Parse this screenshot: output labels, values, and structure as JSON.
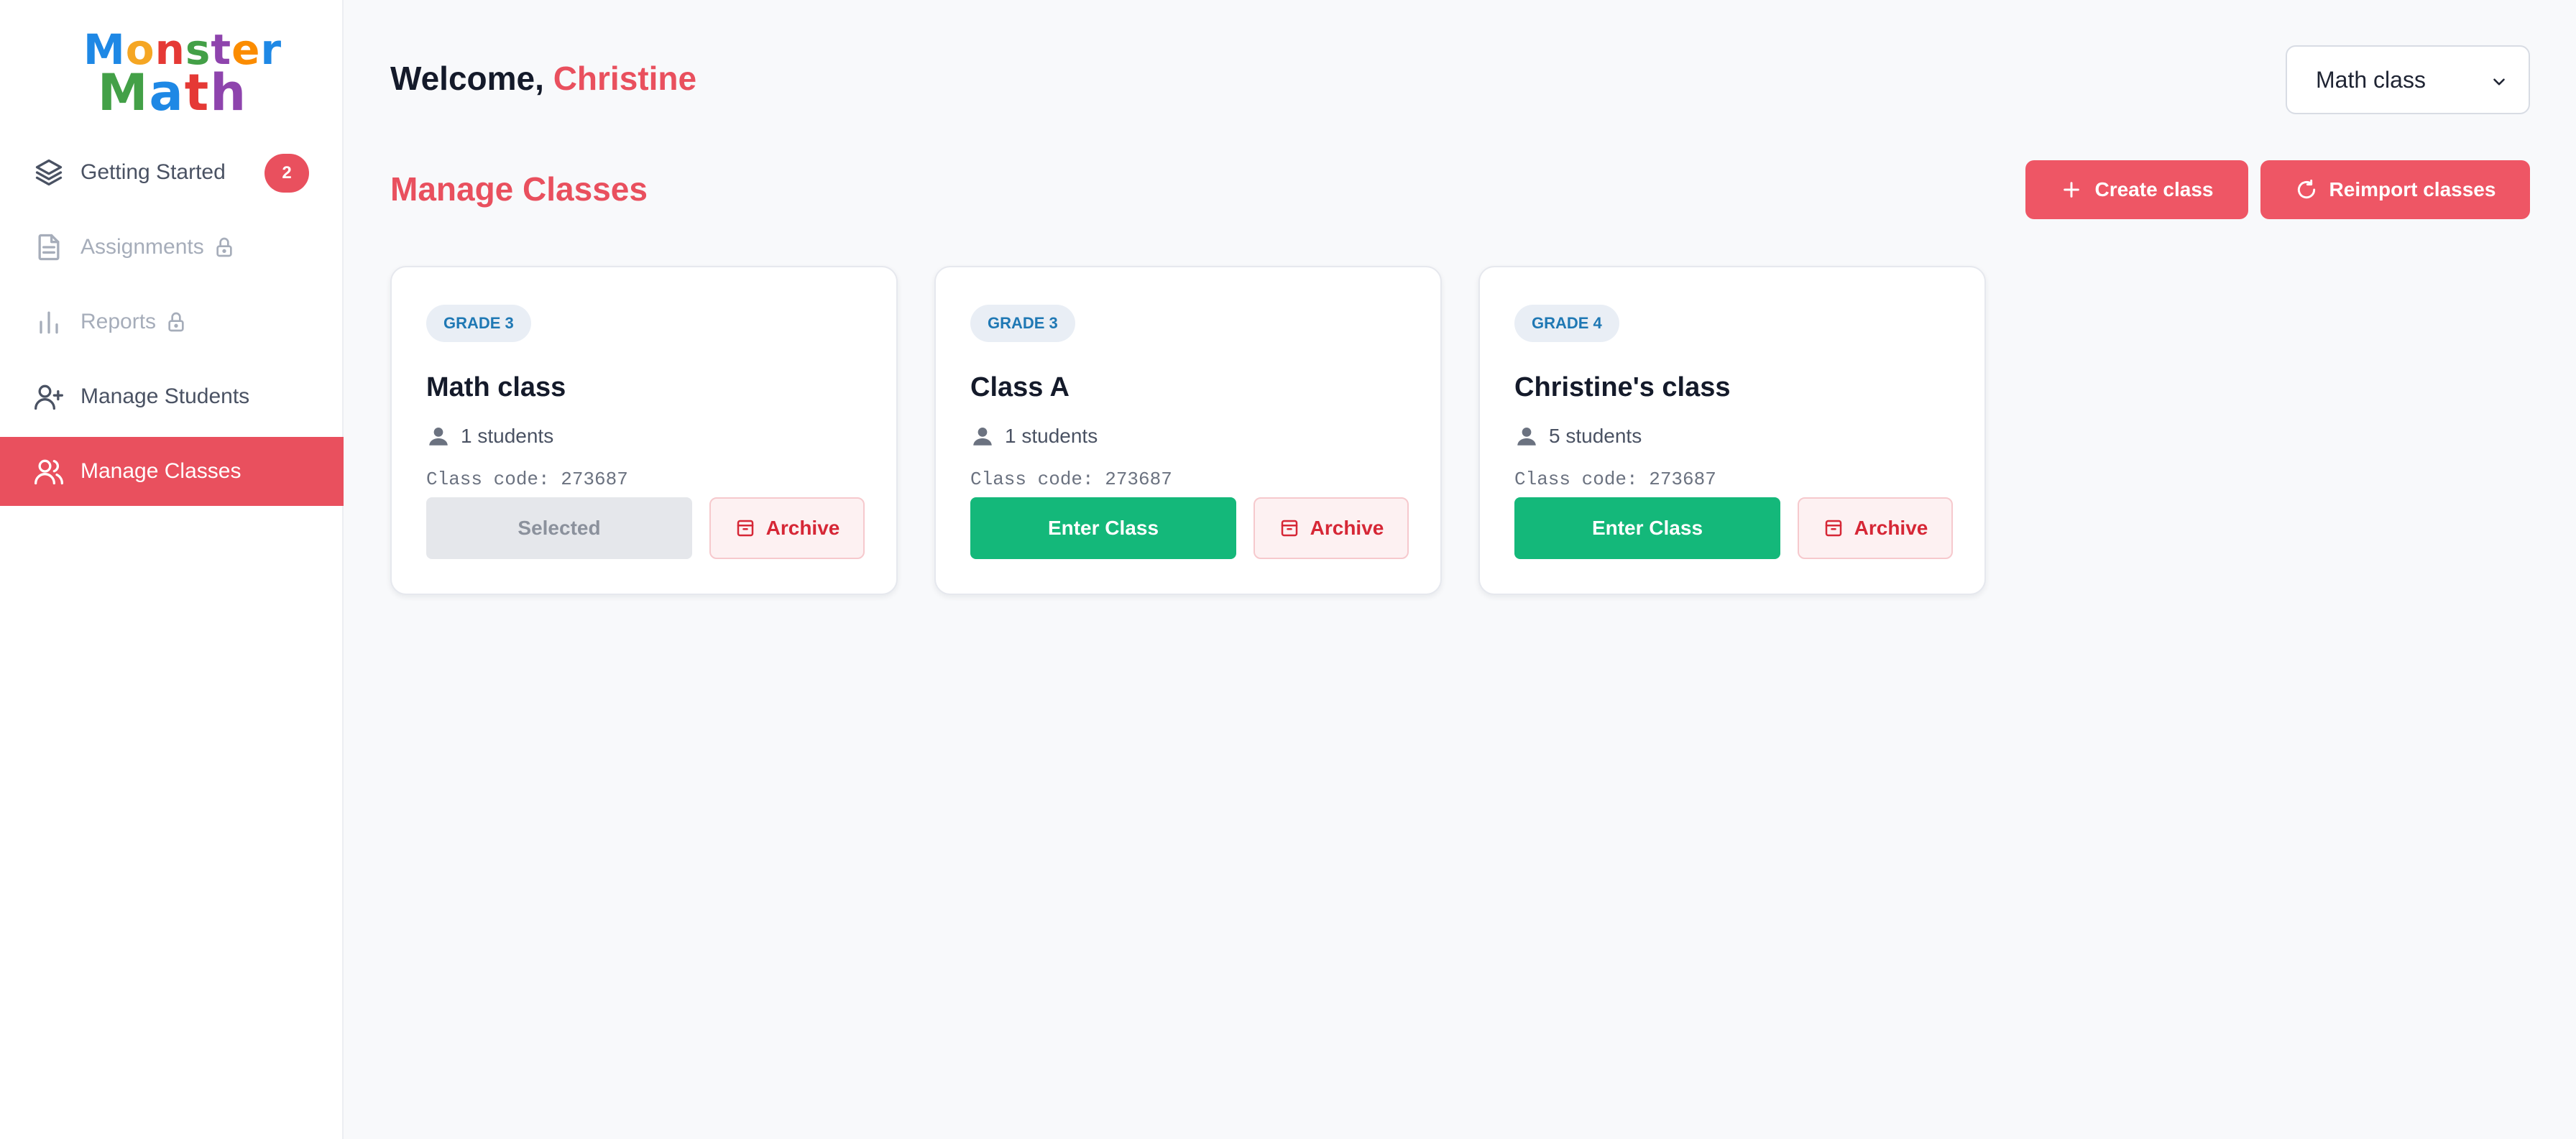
{
  "logo": {
    "line1": [
      "M",
      "o",
      "n",
      "s",
      "t",
      "e",
      "r"
    ],
    "line2": [
      "M",
      "a",
      "t",
      "h"
    ],
    "colors1": [
      "#1e88e5",
      "#f5a623",
      "#e53935",
      "#43a047",
      "#8e44ad",
      "#fb8c00",
      "#1e88e5"
    ],
    "colors2": [
      "#43a047",
      "#1e88e5",
      "#e53935",
      "#8e44ad"
    ]
  },
  "sidebar": {
    "items": [
      {
        "label": "Getting Started",
        "icon": "layers-icon",
        "badge": "2"
      },
      {
        "label": "Assignments",
        "icon": "document-icon",
        "locked": true
      },
      {
        "label": "Reports",
        "icon": "bar-chart-icon",
        "locked": true
      },
      {
        "label": "Manage Students",
        "icon": "user-plus-icon"
      },
      {
        "label": "Manage Classes",
        "icon": "users-icon",
        "active": true
      }
    ]
  },
  "header": {
    "welcome_prefix": "Welcome,",
    "user_name": "Christine",
    "class_select_value": "Math class"
  },
  "main": {
    "title": "Manage Classes",
    "create_label": "Create class",
    "reimport_label": "Reimport classes"
  },
  "classes": [
    {
      "grade": "GRADE 3",
      "name": "Math class",
      "students": "1 students",
      "code": "Class code: 273687",
      "action": "Selected",
      "archive": "Archive"
    },
    {
      "grade": "GRADE 3",
      "name": "Class A",
      "students": "1 students",
      "code": "Class code: 273687",
      "action": "Enter Class",
      "archive": "Archive"
    },
    {
      "grade": "GRADE 4",
      "name": "Christine's class",
      "students": "5 students",
      "code": "Class code: 273687",
      "action": "Enter Class",
      "archive": "Archive"
    }
  ],
  "colors": {
    "accent": "#e9505e",
    "success": "#14b87a",
    "grade_text": "#1f78b4"
  }
}
